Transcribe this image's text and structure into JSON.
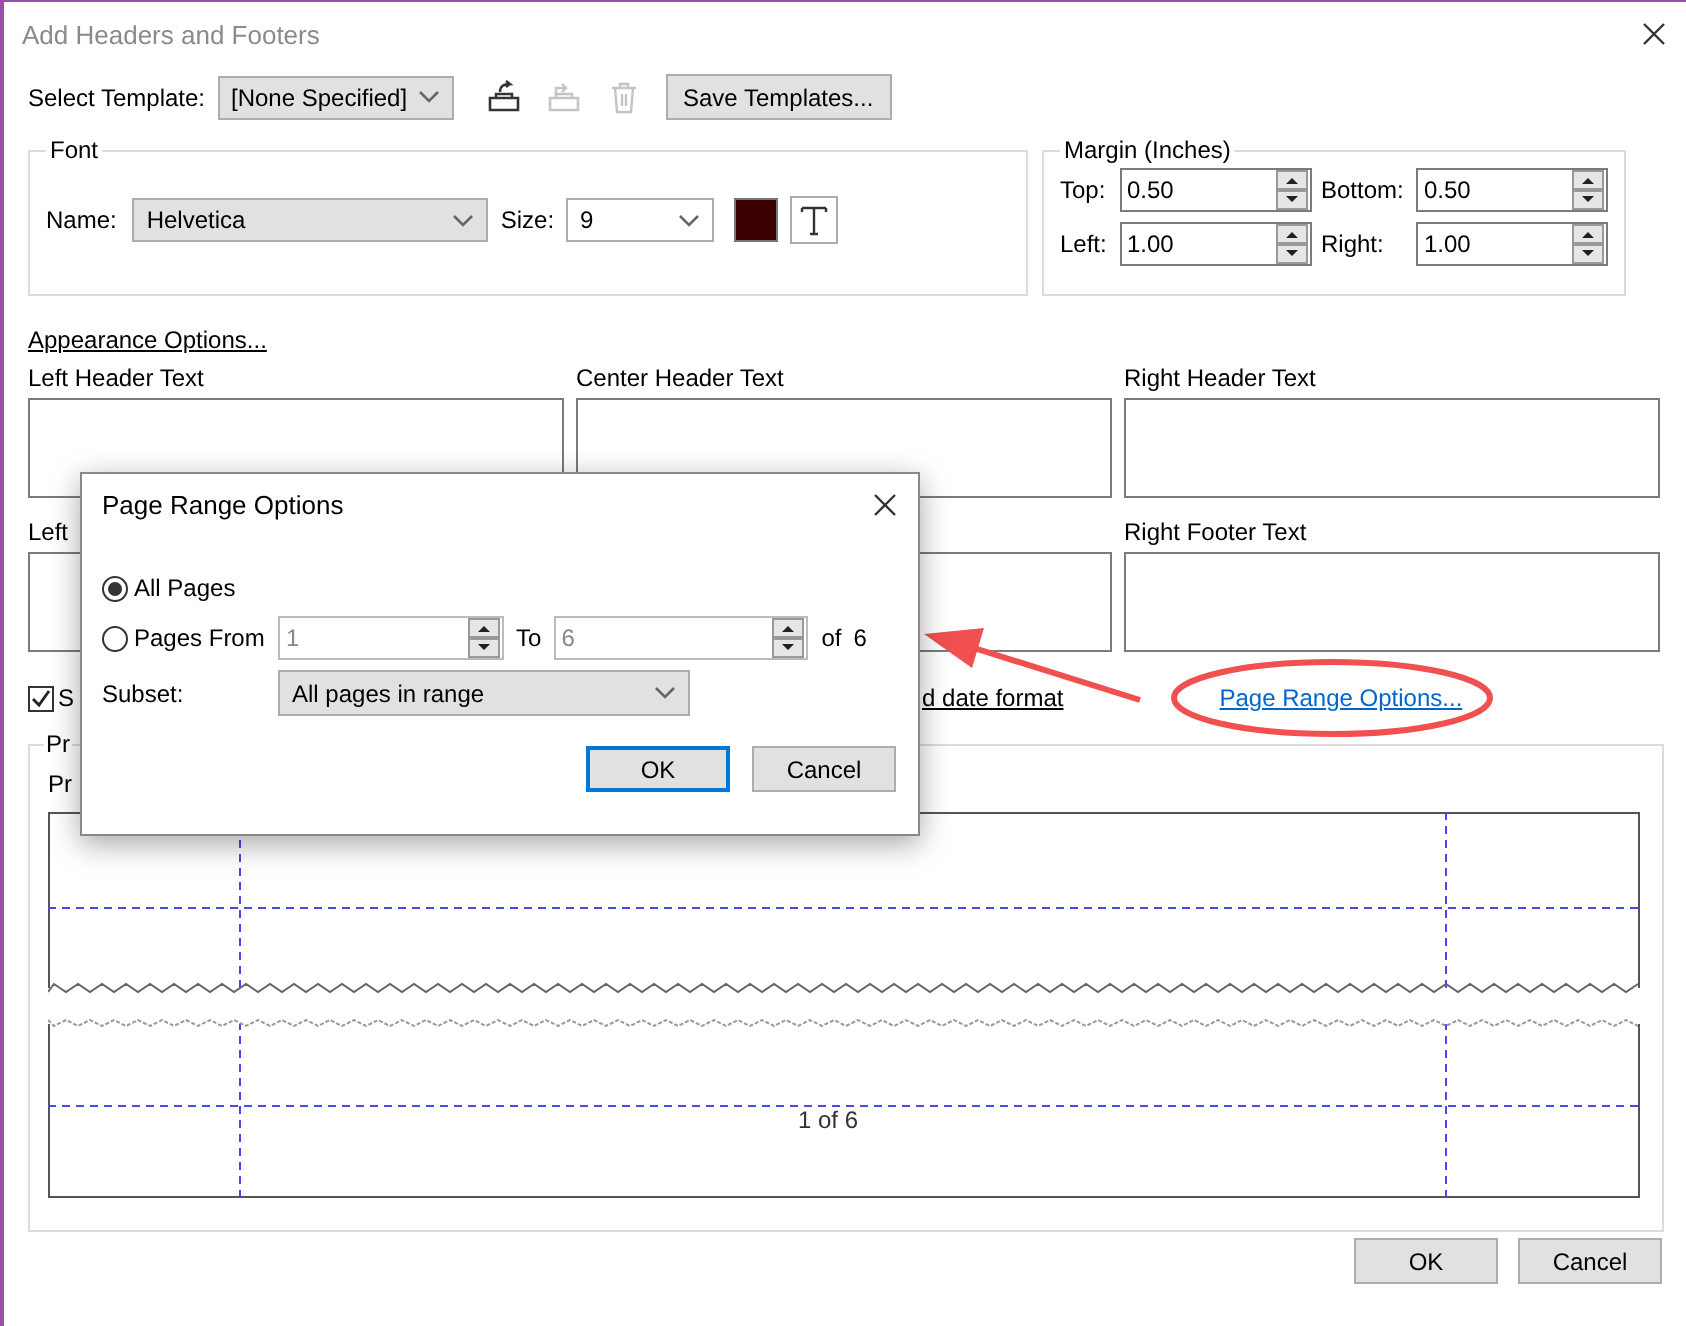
{
  "window": {
    "title": "Add Headers and Footers"
  },
  "template": {
    "label": "Select Template:",
    "value": "[None Specified]",
    "tools": [
      {
        "kind": "import",
        "disabled": false
      },
      {
        "kind": "export",
        "disabled": true
      },
      {
        "kind": "delete",
        "disabled": true
      }
    ],
    "save_button": "Save Templates..."
  },
  "font": {
    "legend": "Font",
    "name_label": "Name:",
    "name": "Helvetica",
    "size_label": "Size:",
    "size": "9",
    "color": "#3a0000"
  },
  "margin": {
    "legend": "Margin (Inches)",
    "fields": [
      {
        "label": "Top:",
        "value": "0.50"
      },
      {
        "label": "Bottom:",
        "value": "0.50"
      },
      {
        "label": "Left:",
        "value": "1.00"
      },
      {
        "label": "Right:",
        "value": "1.00"
      }
    ]
  },
  "appearance_link": "Appearance Options...",
  "headers": [
    {
      "label": "Left Header Text"
    },
    {
      "label": "Center Header Text"
    },
    {
      "label": "Right Header Text"
    }
  ],
  "footers": [
    {
      "label": "Left"
    },
    {
      "label": "Right Footer Text"
    }
  ],
  "shrink_checkbox": {
    "label": "S",
    "checked": true
  },
  "date_link": "d date format",
  "page_range_link": "Page Range Options...",
  "preview": {
    "legend": "Pr",
    "label": "Pr",
    "page_text": "1 of 6"
  },
  "buttons": [
    "OK",
    "Cancel"
  ],
  "modal": {
    "title": "Page Range Options",
    "options": [
      {
        "label": "All Pages",
        "selected": true
      },
      {
        "label": "Pages From",
        "selected": false
      }
    ],
    "from": {
      "value": "1",
      "disabled": true
    },
    "to_label": "To",
    "to": {
      "value": "6",
      "disabled": true
    },
    "of_label": "of",
    "total": "6",
    "subset_label": "Subset:",
    "subset": "All pages in range",
    "buttons": [
      "OK",
      "Cancel"
    ]
  }
}
